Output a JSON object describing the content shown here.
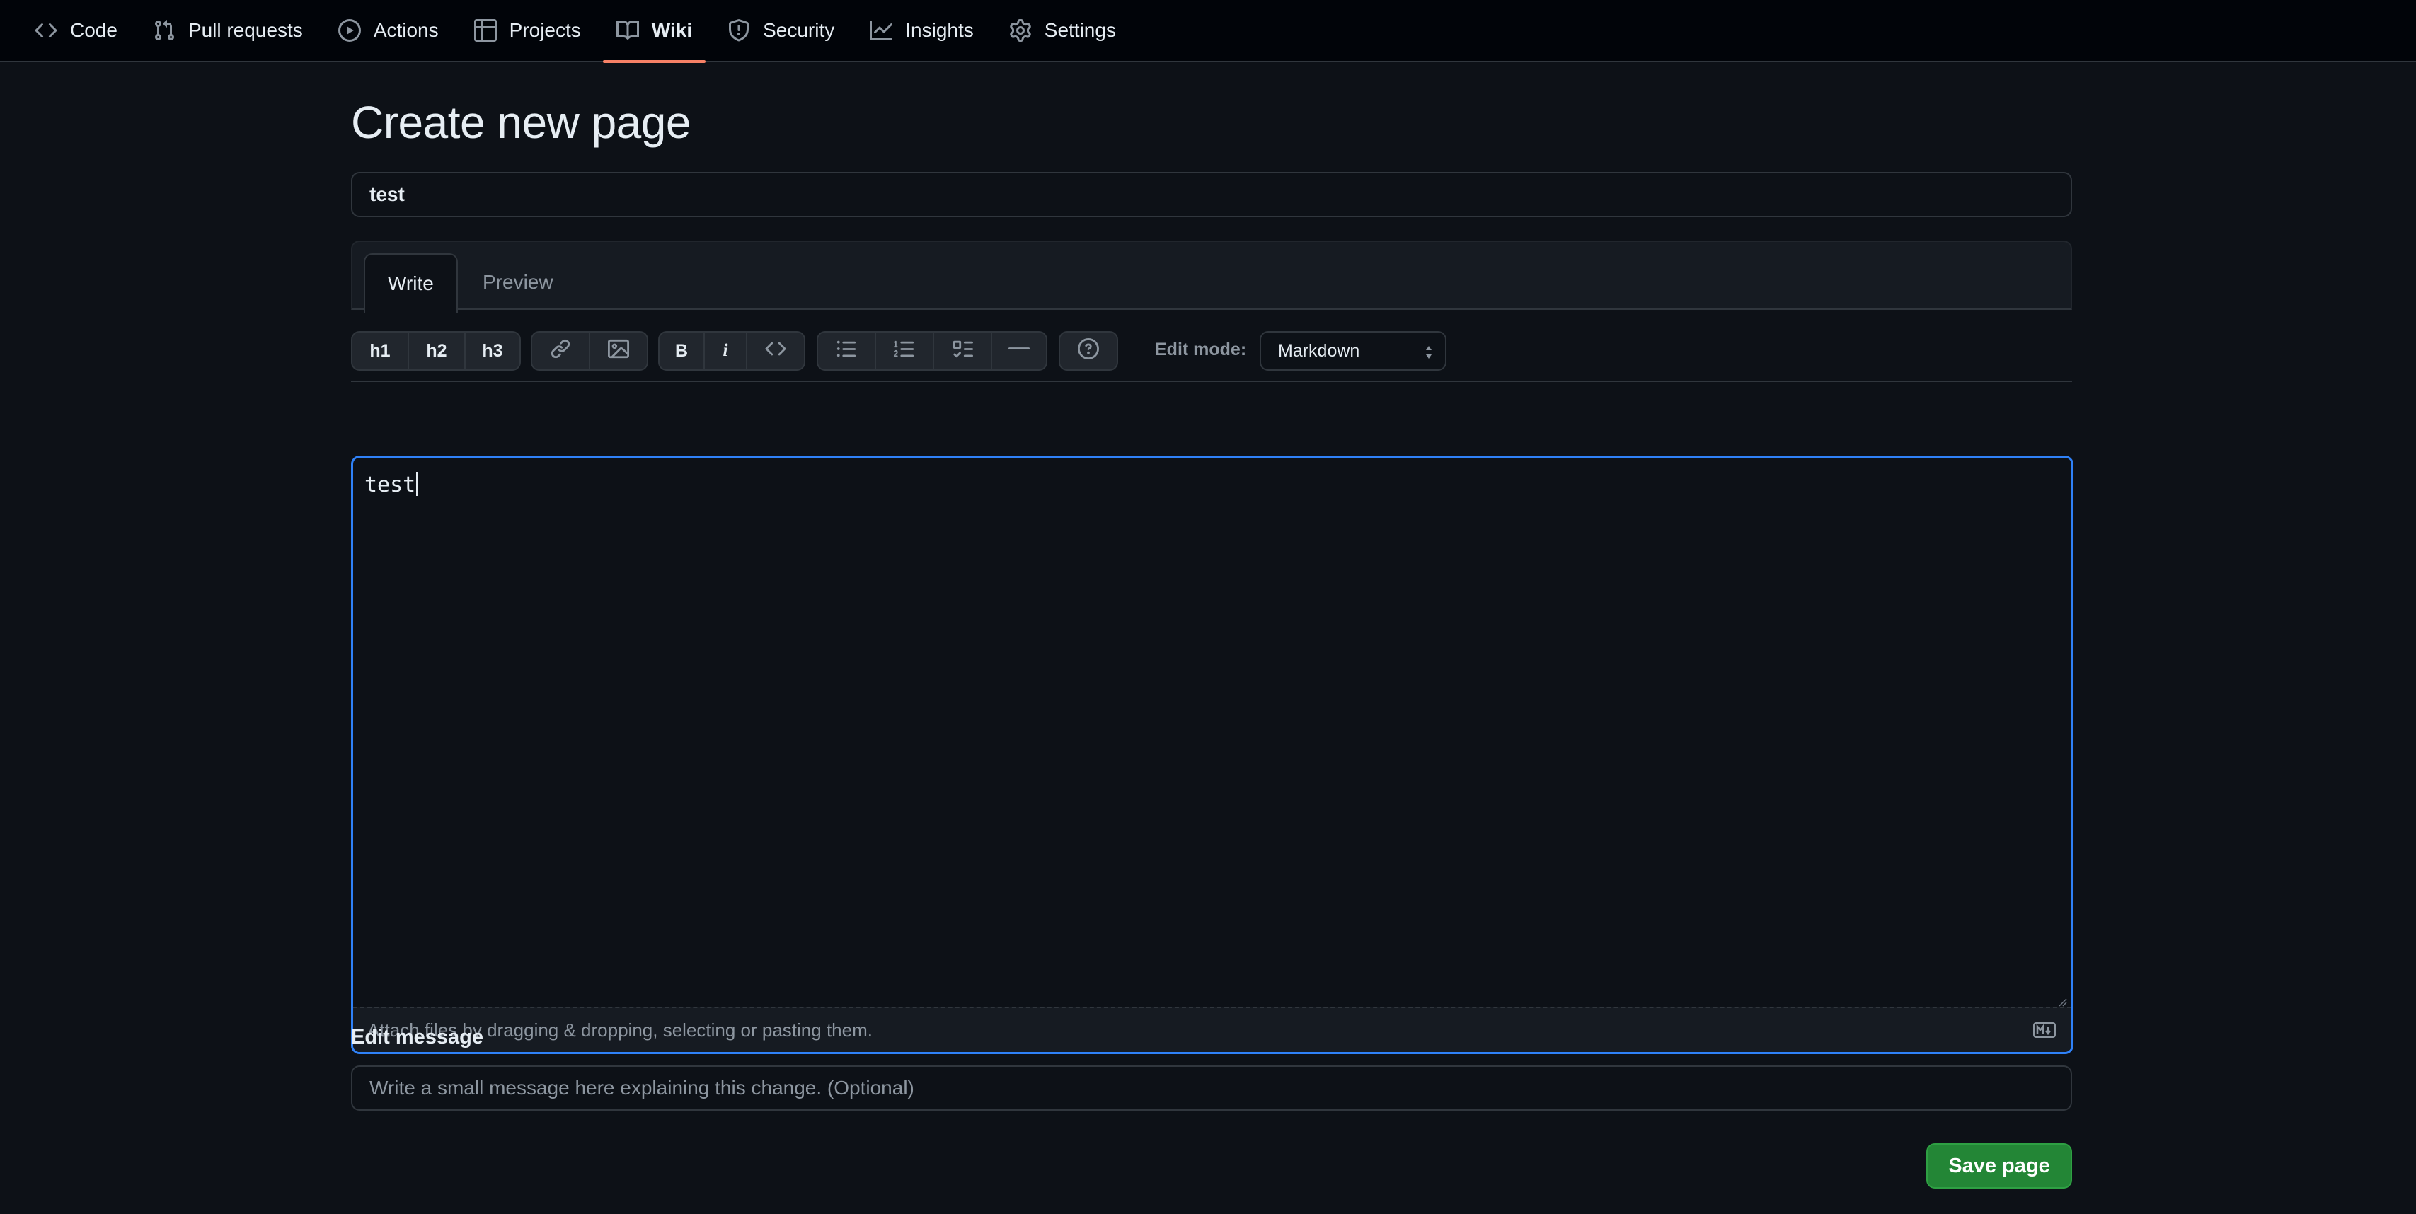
{
  "nav": {
    "items": [
      {
        "label": "Code",
        "icon": "code-icon",
        "active": false
      },
      {
        "label": "Pull requests",
        "icon": "git-pull-request-icon",
        "active": false
      },
      {
        "label": "Actions",
        "icon": "play-icon",
        "active": false
      },
      {
        "label": "Projects",
        "icon": "table-icon",
        "active": false
      },
      {
        "label": "Wiki",
        "icon": "book-icon",
        "active": true
      },
      {
        "label": "Security",
        "icon": "shield-icon",
        "active": false
      },
      {
        "label": "Insights",
        "icon": "graph-icon",
        "active": false
      },
      {
        "label": "Settings",
        "icon": "gear-icon",
        "active": false
      }
    ]
  },
  "page": {
    "title": "Create new page",
    "page_title_value": "test"
  },
  "editor": {
    "tabs": {
      "write": "Write",
      "preview": "Preview"
    },
    "toolbar": {
      "h1": "h1",
      "h2": "h2",
      "h3": "h3",
      "bold": "B",
      "italic": "i"
    },
    "edit_mode_label": "Edit mode:",
    "edit_mode_value": "Markdown",
    "content": "test",
    "attach_hint": "Attach files by dragging & dropping, selecting or pasting them."
  },
  "edit_message": {
    "label": "Edit message",
    "placeholder": "Write a small message here explaining this change. (Optional)"
  },
  "actions": {
    "save_label": "Save page"
  },
  "colors": {
    "accent": "#2f81f7",
    "nav_active_underline": "#f78166",
    "primary_button": "#238636",
    "background": "#0d1117"
  }
}
